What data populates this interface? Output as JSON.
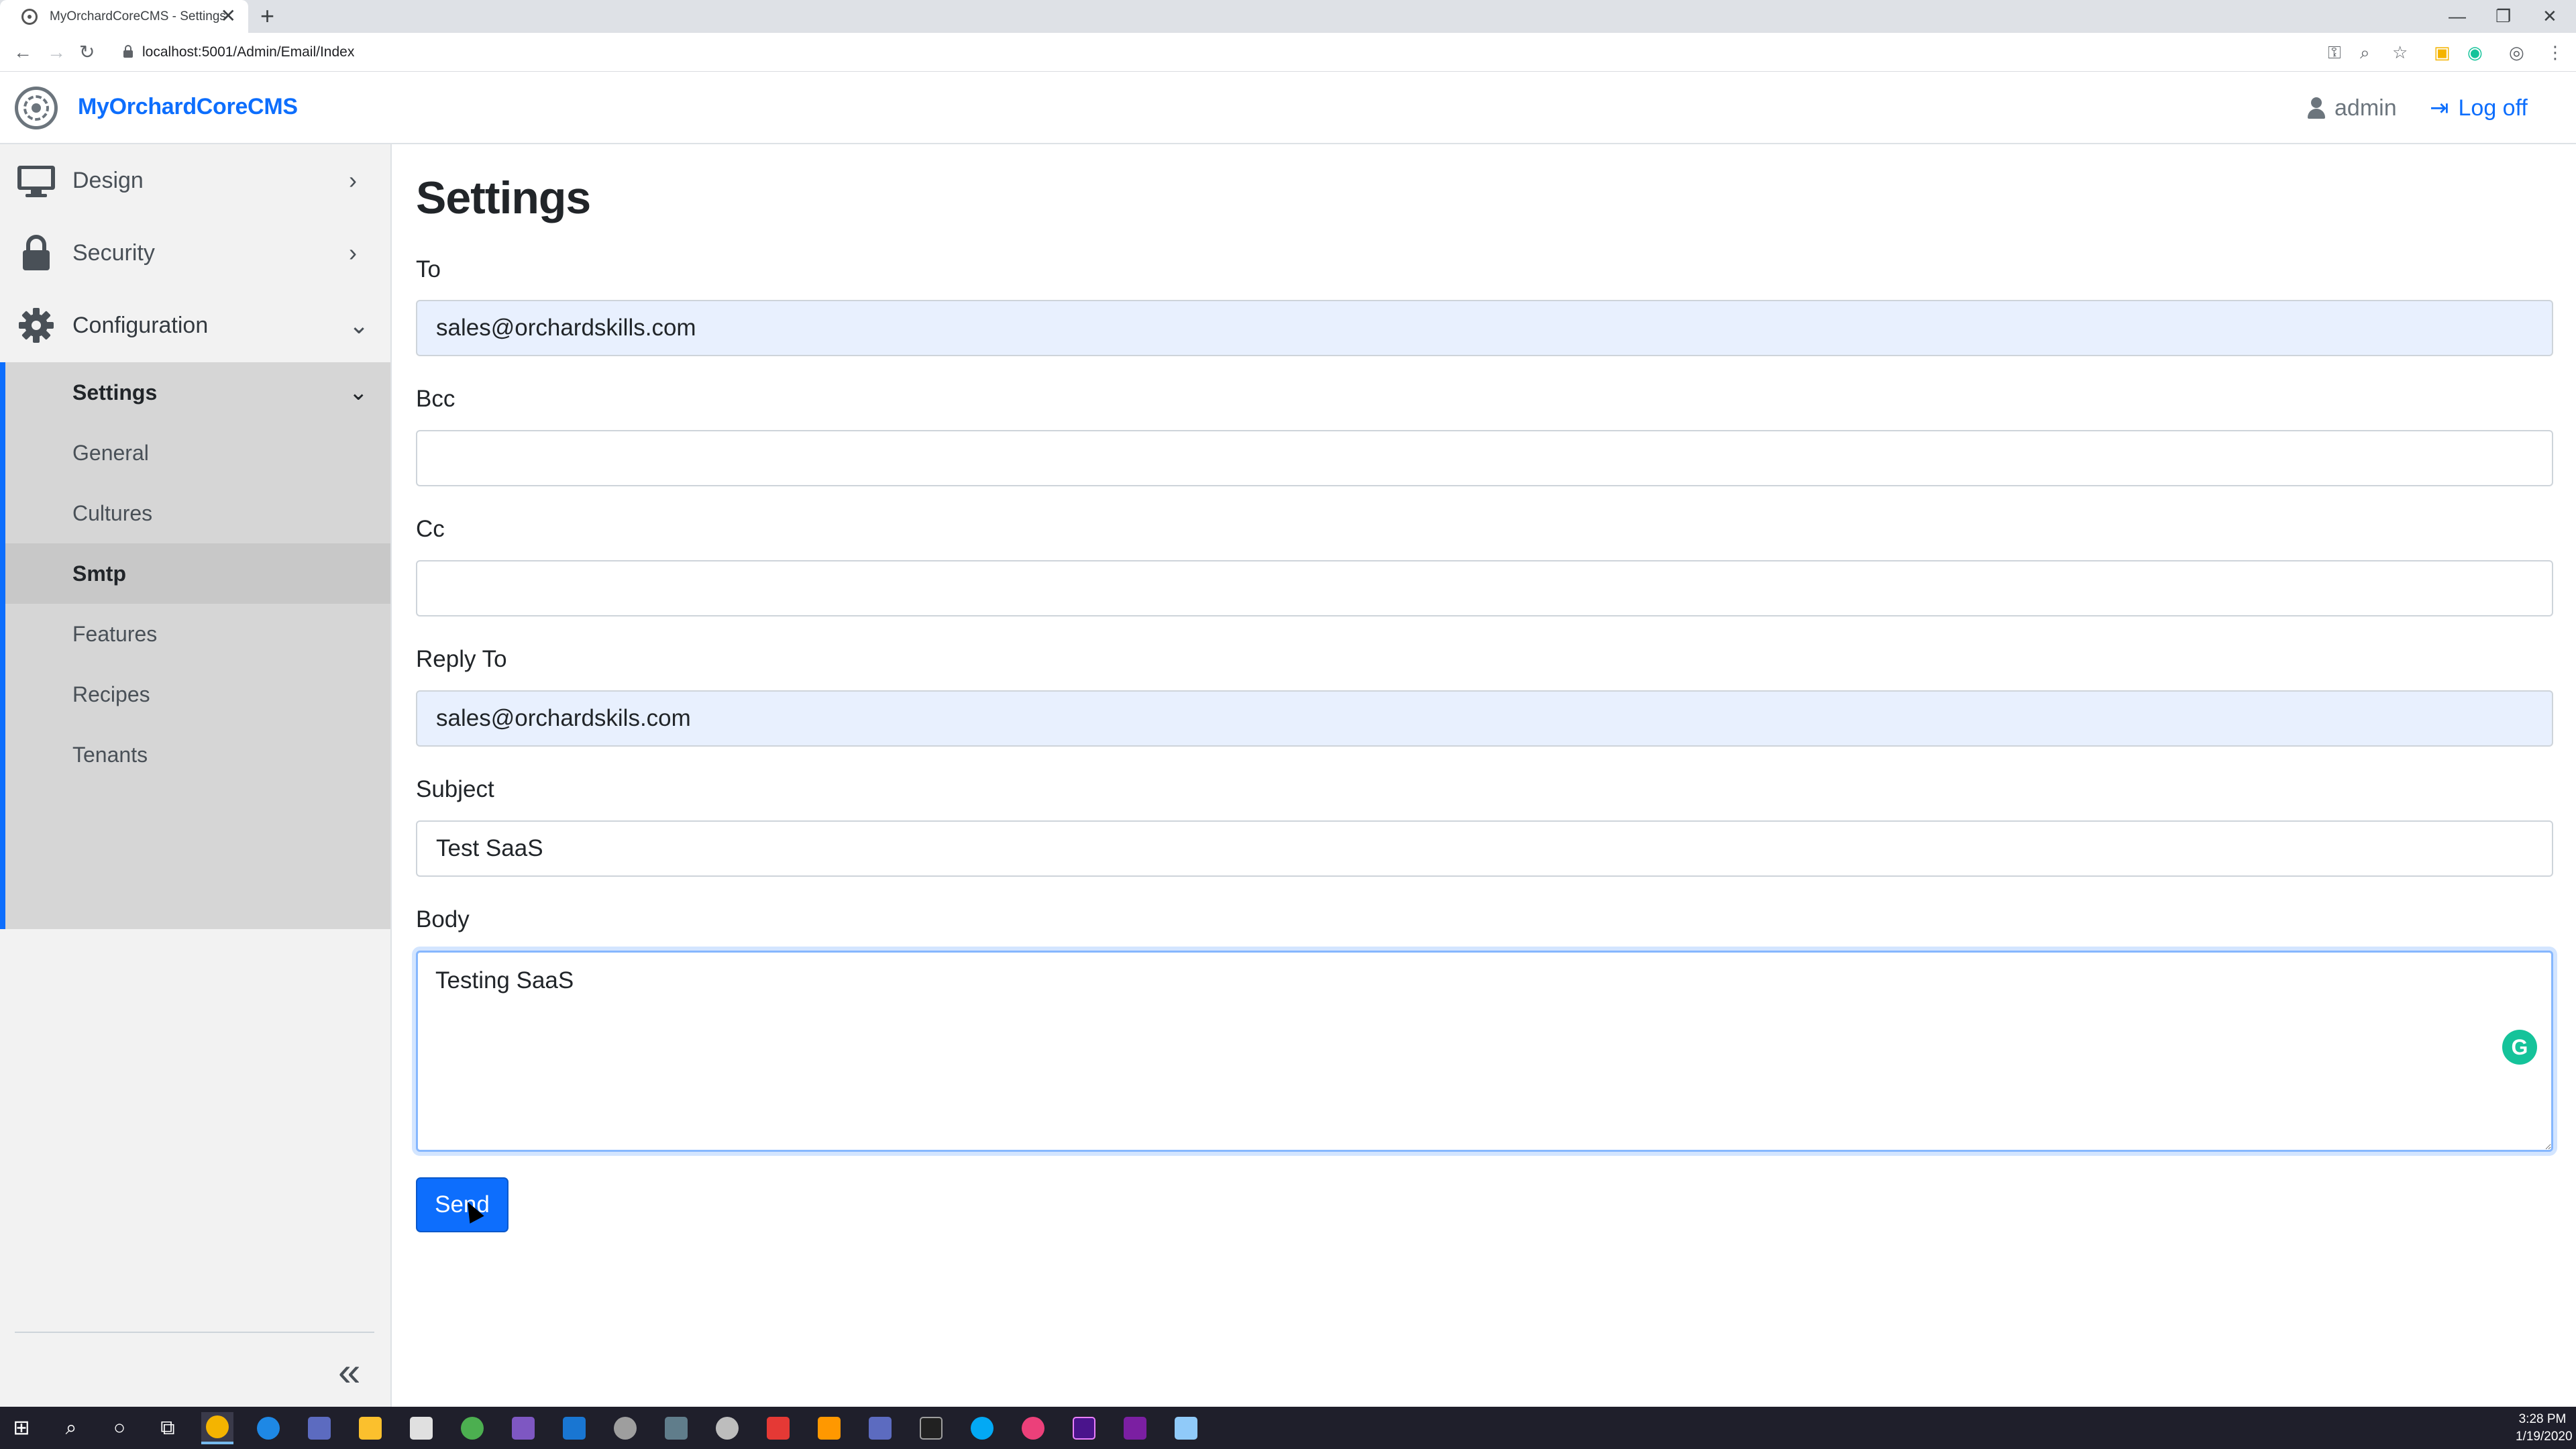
{
  "browser": {
    "tab_title": "MyOrchardCoreCMS - Settings",
    "tab_close": "✕",
    "new_tab": "+",
    "url": "localhost:5001/Admin/Email/Index",
    "window_controls": [
      "—",
      "❐",
      "✕"
    ]
  },
  "header": {
    "brand": "MyOrchardCoreCMS",
    "user": "admin",
    "logoff": "Log off"
  },
  "sidebar": {
    "items": [
      {
        "label": "Design",
        "icon": "monitor-icon"
      },
      {
        "label": "Security",
        "icon": "lock-icon"
      },
      {
        "label": "Configuration",
        "icon": "gear-icon"
      }
    ],
    "submenu_title": "Settings",
    "subitems": [
      "General",
      "Cultures",
      "Smtp",
      "Features",
      "Recipes",
      "Tenants"
    ],
    "active_subitem": "Smtp"
  },
  "main": {
    "title": "Settings",
    "fields": {
      "to": {
        "label": "To",
        "value": "sales@orchardskills.com"
      },
      "bcc": {
        "label": "Bcc",
        "value": ""
      },
      "cc": {
        "label": "Cc",
        "value": ""
      },
      "reply_to": {
        "label": "Reply To",
        "value": "sales@orchardskils.com"
      },
      "subject": {
        "label": "Subject",
        "value": "Test SaaS"
      },
      "body": {
        "label": "Body",
        "value": "Testing SaaS"
      }
    },
    "send_label": "Send"
  },
  "taskbar": {
    "time": "3:28 PM",
    "date": "1/19/2020"
  },
  "colors": {
    "accent": "#0d6efd",
    "sidebar_bg": "#f2f2f2",
    "submenu_bg": "#d6d6d6",
    "autofill_bg": "#e8f0fe",
    "taskbar_bg": "#1f1f2b"
  }
}
